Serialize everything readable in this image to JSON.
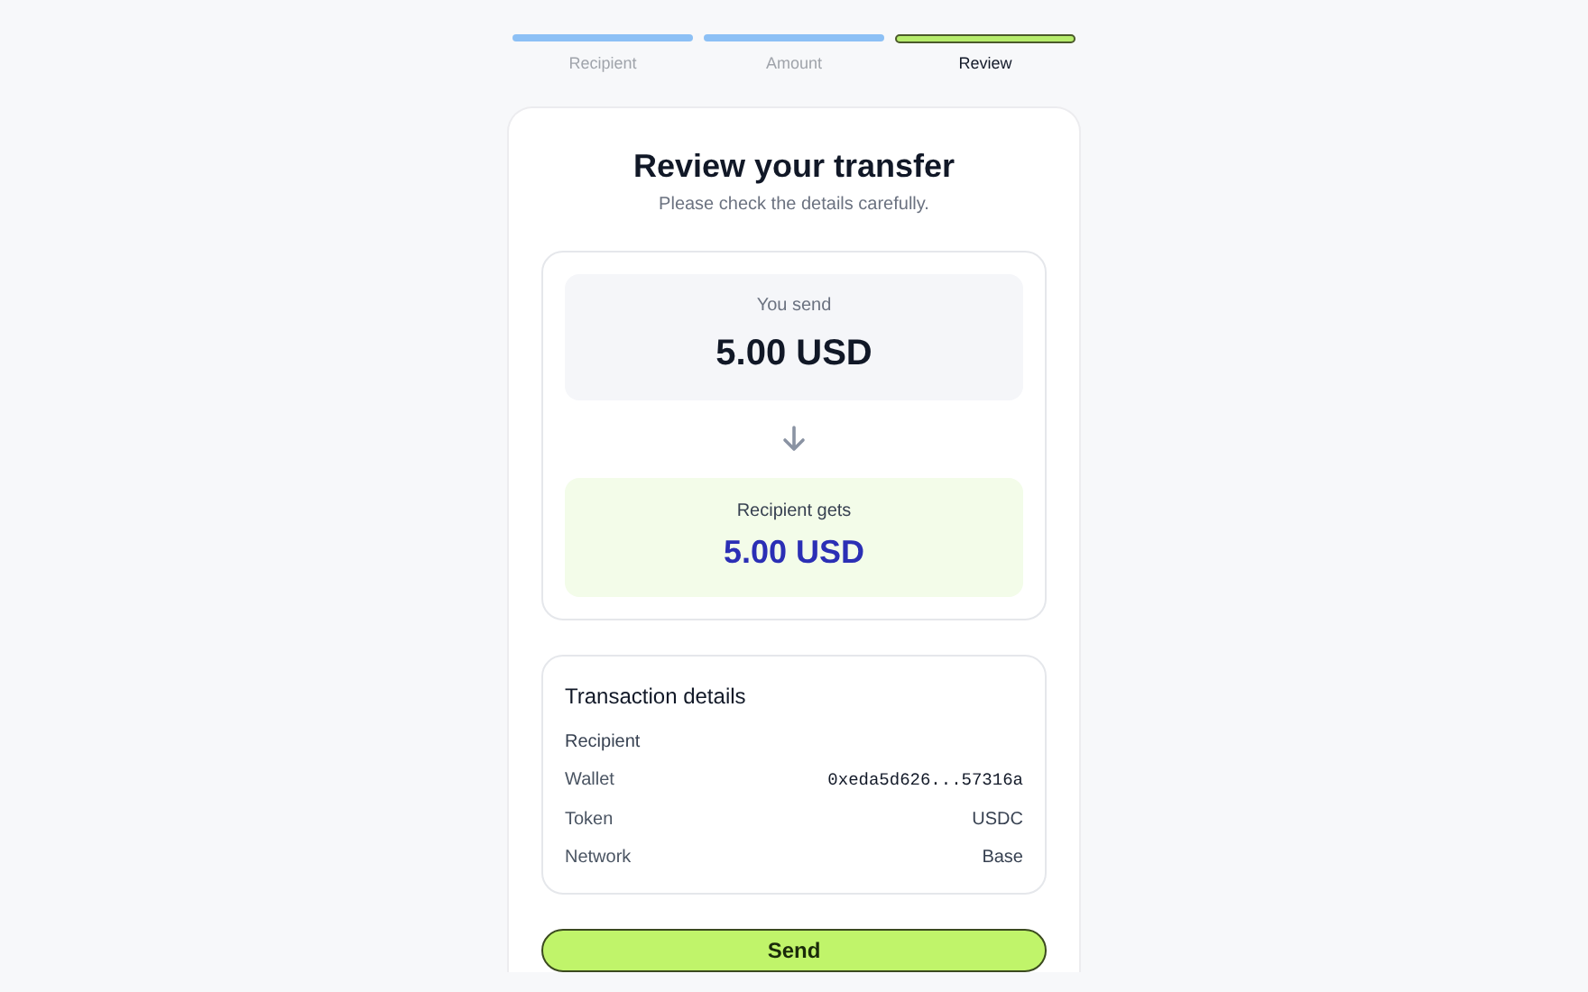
{
  "steps": [
    {
      "label": "Recipient",
      "completed": true,
      "selected": false
    },
    {
      "label": "Amount",
      "completed": true,
      "selected": false
    },
    {
      "label": "Review",
      "completed": false,
      "selected": true
    }
  ],
  "title": "Review your transfer",
  "subtitle": "Please check the details carefully.",
  "send_box": {
    "label": "You send",
    "amount": "5.00 USD"
  },
  "receive_box": {
    "label": "Recipient gets",
    "amount": "5.00 USD"
  },
  "details": {
    "title": "Transaction details",
    "rows": [
      {
        "kind": "heading",
        "label": "Recipient"
      },
      {
        "kind": "address",
        "label": "Wallet",
        "value": "0xeda5d626...57316a"
      },
      {
        "kind": "text",
        "label": "Token",
        "value": "USDC"
      },
      {
        "kind": "text",
        "label": "Network",
        "value": "Base"
      }
    ]
  },
  "send_button": "Send"
}
